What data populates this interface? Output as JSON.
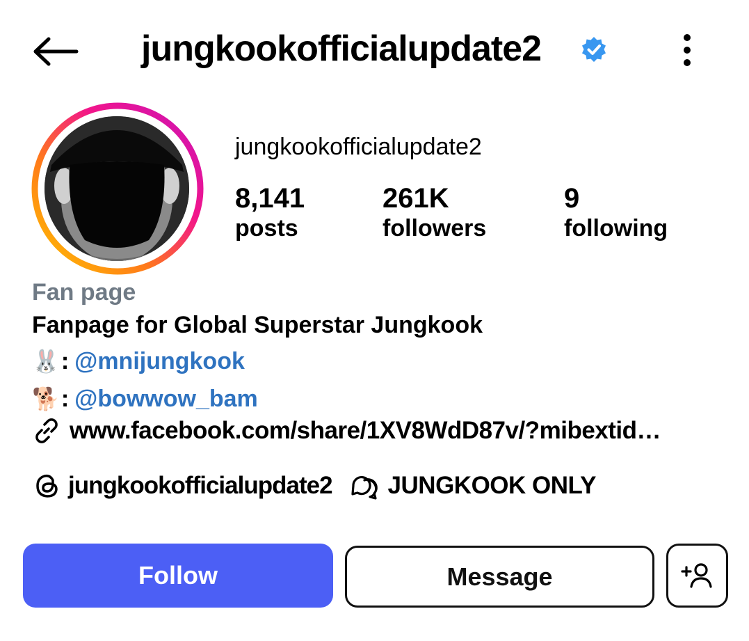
{
  "header": {
    "title": "jungkookofficialupdate2",
    "verified": true,
    "back_icon": "arrow-left-icon",
    "more_icon": "kebab-menu-icon"
  },
  "profile": {
    "name": "jungkookofficialupdate2",
    "stats": [
      {
        "value": "8,141",
        "label": "posts"
      },
      {
        "value": "261K",
        "label": "followers"
      },
      {
        "value": "9",
        "label": "following"
      }
    ],
    "category": "Fan page",
    "bio": "Fanpage for Global Superstar Jungkook",
    "lines": [
      {
        "emoji": "🐰",
        "sep": ":",
        "mention": "@mnijungkook"
      },
      {
        "emoji": "🐕",
        "sep": ":",
        "mention": "@bowwow_bam"
      }
    ],
    "link": "www.facebook.com/share/1XV8WdD87v/?mibextid…",
    "threads_handle": "jungkookofficialupdate2",
    "channel_name": "JUNGKOOK ONLY"
  },
  "actions": {
    "follow_label": "Follow",
    "message_label": "Message"
  },
  "colors": {
    "follow_bg": "#4c5ff5",
    "mention": "#2f73c0",
    "category": "#6f7a85",
    "verified": "#3897f0"
  }
}
